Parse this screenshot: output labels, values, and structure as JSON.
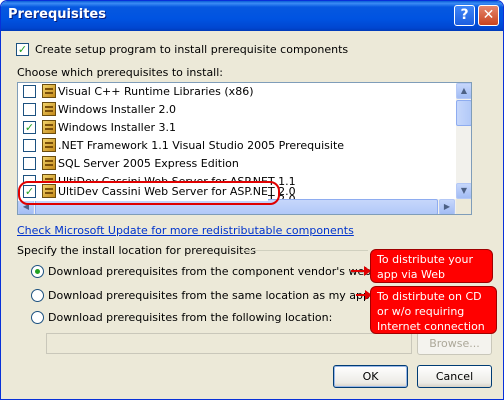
{
  "window": {
    "title": "Prerequisites",
    "help_glyph": "?",
    "close_glyph": "✕"
  },
  "create_setup": {
    "label": "Create setup program to install prerequisite components",
    "checked": true
  },
  "choose_label": "Choose which prerequisites to install:",
  "prerequisites": [
    {
      "label": "Visual C++ Runtime Libraries (x86)",
      "checked": false
    },
    {
      "label": "Windows Installer 2.0",
      "checked": false
    },
    {
      "label": "Windows Installer 3.1",
      "checked": true
    },
    {
      "label": ".NET Framework 1.1 Visual Studio 2005 Prerequisite",
      "checked": false
    },
    {
      "label": "SQL Server 2005 Express Edition",
      "checked": false
    },
    {
      "label": "UltiDev Cassini Web Server for ASP.NET 1.1",
      "checked": false
    },
    {
      "label": "UltiDev Cassini Web Server for ASP.NET 2.0",
      "checked": true
    }
  ],
  "scroll": {
    "up": "▲",
    "down": "▼",
    "left": "◀",
    "right": "▶"
  },
  "update_link": "Check Microsoft Update for more redistributable components",
  "location_heading": "Specify the install location for prerequisites",
  "location_options": [
    {
      "label": "Download prerequisites from the component vendor's web site",
      "selected": true
    },
    {
      "label": "Download prerequisites from the same location as my application",
      "selected": false
    },
    {
      "label": "Download prerequisites from the following location:",
      "selected": false
    }
  ],
  "location_path": {
    "value": ""
  },
  "buttons": {
    "browse": "Browse...",
    "ok": "OK",
    "cancel": "Cancel"
  },
  "annotations": {
    "web": "To distribute your app via Web",
    "cd": "To distirbute on CD or w/o requiring Internet connection"
  },
  "colors": {
    "title_bar": "#0053e1",
    "dialog_bg": "#ece9d8",
    "link": "#0033cc",
    "annotation": "#ff0000",
    "check": "#21a121"
  }
}
